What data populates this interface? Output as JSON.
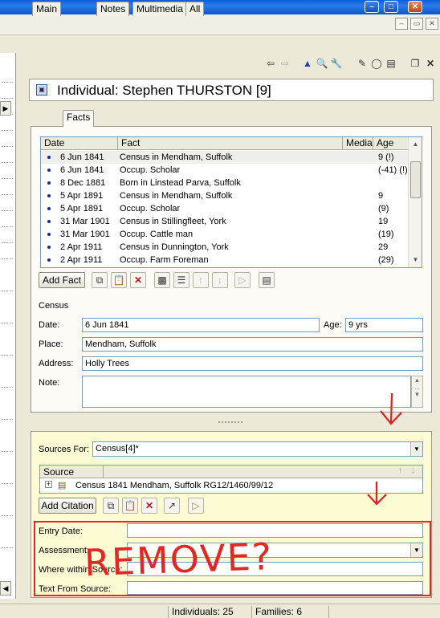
{
  "window": {
    "titlebar_buttons": [
      "minimize",
      "restore",
      "close"
    ]
  },
  "toolbar": {
    "icons": [
      "back-arrow-icon",
      "forward-arrow-icon",
      "triangle-icon",
      "magnifier-icon",
      "wrench-icon",
      "edit-icon",
      "eraser-icon",
      "report-icon",
      "restore-icon",
      "close-icon"
    ]
  },
  "header": {
    "title": "Individual: Stephen THURSTON [9]"
  },
  "tabs": [
    {
      "label": "Main"
    },
    {
      "label": "Facts"
    },
    {
      "label": "Notes"
    },
    {
      "label": "Multimedia"
    },
    {
      "label": "All"
    }
  ],
  "facts_grid": {
    "columns": [
      "Date",
      "Fact",
      "Media",
      "Age"
    ],
    "rows": [
      {
        "date": "6 Jun 1841",
        "fact": "Census in Mendham, Suffolk",
        "age": "9 (!)"
      },
      {
        "date": "6 Jun 1841",
        "fact": "Occup. Scholar",
        "age": "(-41) (!)"
      },
      {
        "date": "8 Dec 1881",
        "fact": "Born in Linstead Parva, Suffolk",
        "age": ""
      },
      {
        "date": "5 Apr 1891",
        "fact": "Census in Mendham, Suffolk",
        "age": "9"
      },
      {
        "date": "5 Apr 1891",
        "fact": "Occup. Scholar",
        "age": "(9)"
      },
      {
        "date": "31 Mar 1901",
        "fact": "Census in Stillingfleet, York",
        "age": "19"
      },
      {
        "date": "31 Mar 1901",
        "fact": "Occup. Cattle man",
        "age": "(19)"
      },
      {
        "date": "2 Apr 1911",
        "fact": "Census in Dunnington, York",
        "age": "29"
      },
      {
        "date": "2 Apr 1911",
        "fact": "Occup. Farm Foreman",
        "age": "(29)"
      }
    ]
  },
  "fact_buttons": {
    "add_fact": "Add Fact"
  },
  "fact_detail": {
    "type": "Census",
    "date_label": "Date:",
    "date_value": "6 Jun 1841",
    "age_label": "Age:",
    "age_value": "9 yrs",
    "place_label": "Place:",
    "place_value": "Mendham, Suffolk",
    "address_label": "Address:",
    "address_value": "Holly Trees",
    "note_label": "Note:",
    "note_value": ""
  },
  "sources": {
    "label": "Sources For:",
    "selected": "Census[4]*",
    "grid_header": "Source",
    "grid_rows": [
      "Census 1841 Mendham, Suffolk RG12/1460/99/12"
    ],
    "add_citation": "Add Citation",
    "entry_date_label": "Entry Date:",
    "assessment_label": "Assessment:",
    "where_label": "Where within Source:",
    "text_label": "Text From Source:"
  },
  "annotation": {
    "text": "REMOVE?",
    "color": "#e32626"
  },
  "status": {
    "individuals": "Individuals: 25",
    "families": "Families: 6"
  }
}
